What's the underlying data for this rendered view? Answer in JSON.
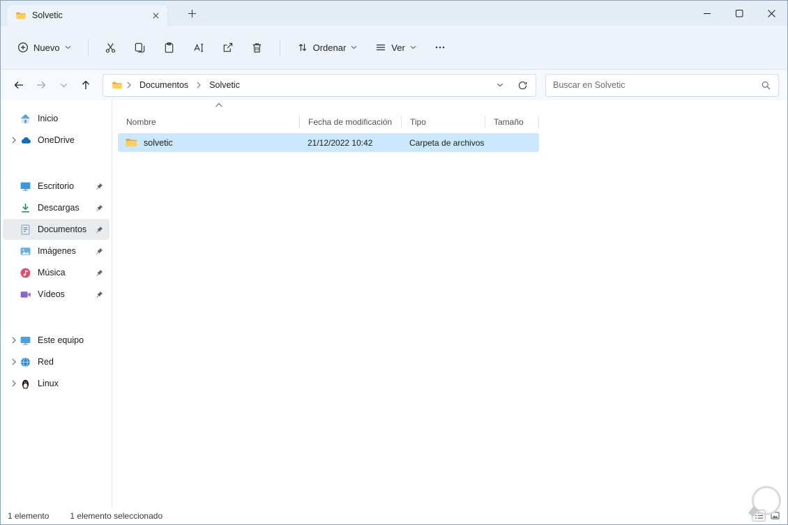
{
  "window": {
    "tab_title": "Solvetic"
  },
  "toolbar": {
    "new_label": "Nuevo",
    "sort_label": "Ordenar",
    "view_label": "Ver"
  },
  "navigation": {
    "breadcrumb": [
      "Documentos",
      "Solvetic"
    ],
    "search_placeholder": "Buscar en Solvetic"
  },
  "sidebar": {
    "home": "Inicio",
    "onedrive": "OneDrive",
    "pinned": [
      {
        "label": "Escritorio"
      },
      {
        "label": "Descargas"
      },
      {
        "label": "Documentos"
      },
      {
        "label": "Imágenes"
      },
      {
        "label": "Música"
      },
      {
        "label": "Vídeos"
      }
    ],
    "devices": [
      {
        "label": "Este equipo"
      },
      {
        "label": "Red"
      },
      {
        "label": "Linux"
      }
    ]
  },
  "files": {
    "columns": {
      "name": "Nombre",
      "date": "Fecha de modificación",
      "type": "Tipo",
      "size": "Tamaño"
    },
    "items": [
      {
        "name": "solvetic",
        "date": "21/12/2022 10:42",
        "type": "Carpeta de archivos",
        "size": ""
      }
    ]
  },
  "statusbar": {
    "items_count": "1 elemento",
    "selection_count": "1 elemento seleccionado"
  },
  "colors": {
    "selection_highlight": "#cce8ff",
    "chrome_background": "#e7eef7",
    "folder_yellow": "#ffd05e",
    "sidebar_selected": "#e9ecef"
  }
}
